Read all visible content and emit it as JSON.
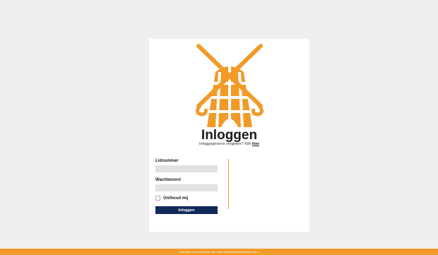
{
  "login": {
    "title": "Inloggen",
    "forgot_text": "Inloggegevens vergeten? Klik ",
    "forgot_link": "hier",
    "member_label": "Lidnummer",
    "password_label": "Wachtwoord",
    "remember_label": "Onthoud mij",
    "submit_label": "Inloggen"
  },
  "footer": {
    "text": "LISATeam is een product van LISA Ledeninformatiesysteem B.V."
  },
  "colors": {
    "accent": "#f29a28",
    "button": "#12295a",
    "background": "#efefef"
  }
}
